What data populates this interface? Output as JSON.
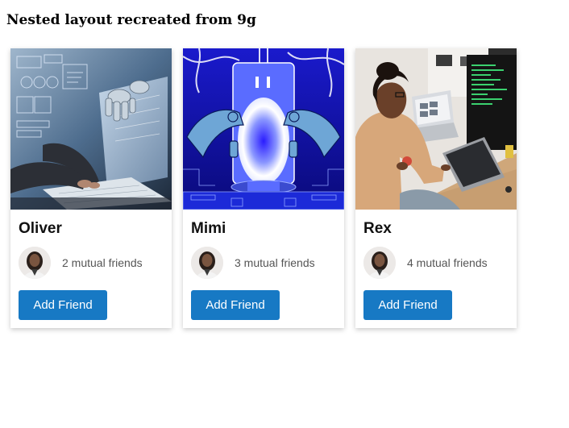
{
  "page": {
    "title": "Nested layout recreated from 9g"
  },
  "cards": [
    {
      "name": "Oliver",
      "mutual_friends": "2 mutual friends",
      "button_label": "Add Friend",
      "image_subject": "robot-hand-and-person-typing-on-laptop"
    },
    {
      "name": "Mimi",
      "mutual_friends": "3 mutual friends",
      "button_label": "Add Friend",
      "image_subject": "robot-hands-around-glowing-portal"
    },
    {
      "name": "Rex",
      "mutual_friends": "4 mutual friends",
      "button_label": "Add Friend",
      "image_subject": "woman-working-at-desk-with-monitors"
    }
  ],
  "colors": {
    "button_bg": "#1779c4",
    "button_text": "#ffffff",
    "mutual_text": "#555555"
  }
}
